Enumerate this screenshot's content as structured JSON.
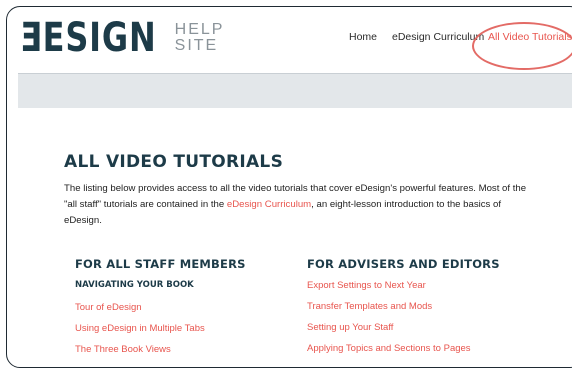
{
  "logo": {
    "main": "ƎESIGN",
    "side_top": "HELP",
    "side_bottom": "SITE"
  },
  "nav": {
    "home": "Home",
    "curriculum": "eDesign Curriculum",
    "all_video": "All Video Tutorials"
  },
  "colors": {
    "accent": "#e8554e",
    "heading": "#1d3b48",
    "banner": "#e3e7ea"
  },
  "page": {
    "title": "ALL VIDEO TUTORIALS",
    "intro_before": "The listing below provides access to all the video tutorials that cover eDesign's powerful features. Most of the \"all staff\" tutorials are contained in the ",
    "intro_link": "eDesign Curriculum",
    "intro_after": ", an eight-lesson introduction to the basics of eDesign."
  },
  "columns": {
    "staff": {
      "heading": "FOR ALL STAFF MEMBERS",
      "subheading": "NAVIGATING YOUR BOOK",
      "links": [
        "Tour of eDesign",
        "Using eDesign in Multiple Tabs",
        "The Three Book Views"
      ]
    },
    "advisers": {
      "heading": "FOR ADVISERS AND EDITORS",
      "links": [
        "Export Settings to Next Year",
        "Transfer Templates and Mods",
        "Setting up Your Staff",
        "Applying Topics and Sections to Pages"
      ]
    }
  }
}
